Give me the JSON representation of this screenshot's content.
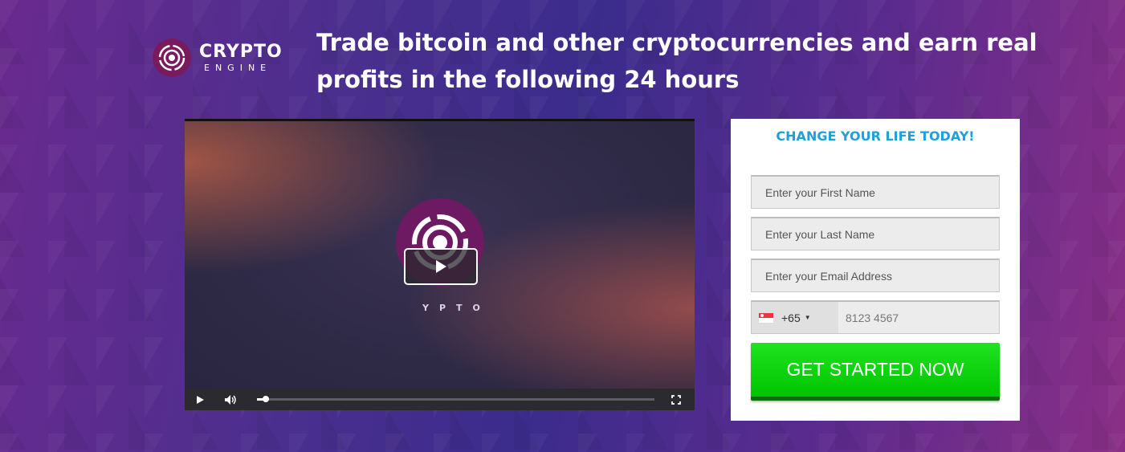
{
  "logo": {
    "line1": "CRYPTO",
    "line2": "ENGINE"
  },
  "headline": "Trade bitcoin and other cryptocurrencies and earn real profits in the following 24 hours",
  "video": {
    "wordmark": "YPTO"
  },
  "form": {
    "title": "CHANGE YOUR LIFE TODAY!",
    "first_name_placeholder": "Enter your First Name",
    "last_name_placeholder": "Enter your Last Name",
    "email_placeholder": "Enter your Email Address",
    "country_code": "+65",
    "phone_placeholder": "8123 4567",
    "submit_label": "GET STARTED NOW"
  },
  "colors": {
    "title_blue": "#1ea0dc",
    "cta_green": "#00c400",
    "logo_purple": "#7a1a5e"
  }
}
